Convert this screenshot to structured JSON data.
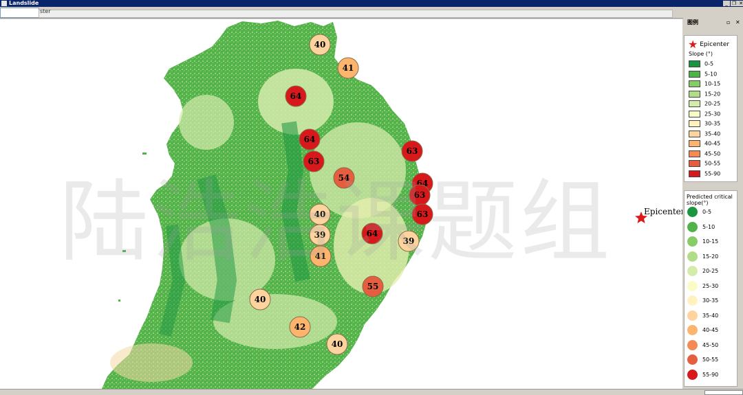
{
  "app": {
    "title": "Landslide"
  },
  "tabs": {
    "active_label": "ster"
  },
  "legend": {
    "header": "图例",
    "epicenter_label": "Epicenter",
    "slope_title": "Slope (°)",
    "slope_classes": [
      {
        "label": "0-5",
        "color": "#1a9641"
      },
      {
        "label": "5-10",
        "color": "#4fb34a"
      },
      {
        "label": "10-15",
        "color": "#86cc67"
      },
      {
        "label": "15-20",
        "color": "#b2dd88"
      },
      {
        "label": "20-25",
        "color": "#d5ebac"
      },
      {
        "label": "25-30",
        "color": "#fafcc8"
      },
      {
        "label": "30-35",
        "color": "#fff2c0"
      },
      {
        "label": "35-40",
        "color": "#fdd49e"
      },
      {
        "label": "40-45",
        "color": "#fdb56e"
      },
      {
        "label": "45-50",
        "color": "#f48b55"
      },
      {
        "label": "50-55",
        "color": "#e45e3f"
      },
      {
        "label": "55-90",
        "color": "#d7191c"
      }
    ],
    "critical_title": "Predicted critical slope(°)",
    "critical_classes": [
      {
        "label": "0-5",
        "color": "#1a9641"
      },
      {
        "label": "5-10",
        "color": "#4fb34a"
      },
      {
        "label": "10-15",
        "color": "#86cc67"
      },
      {
        "label": "15-20",
        "color": "#b2dd88"
      },
      {
        "label": "20-25",
        "color": "#d5ebac"
      },
      {
        "label": "25-30",
        "color": "#fafcc8"
      },
      {
        "label": "30-35",
        "color": "#fff2c0"
      },
      {
        "label": "35-40",
        "color": "#fdd49e"
      },
      {
        "label": "40-45",
        "color": "#fdb56e"
      },
      {
        "label": "45-50",
        "color": "#f48b55"
      },
      {
        "label": "50-55",
        "color": "#e45e3f"
      },
      {
        "label": "55-90",
        "color": "#d7191c"
      }
    ]
  },
  "map": {
    "epicenter_label": "Epicenter",
    "watermark": "陆浩浩课题组",
    "markers": [
      {
        "value": "40",
        "color": "#fdd49e"
      },
      {
        "value": "41",
        "color": "#fdb56e"
      },
      {
        "value": "64",
        "color": "#d7191c"
      },
      {
        "value": "64",
        "color": "#d7191c"
      },
      {
        "value": "63",
        "color": "#d7191c"
      },
      {
        "value": "54",
        "color": "#e45e3f"
      },
      {
        "value": "63",
        "color": "#d7191c"
      },
      {
        "value": "64",
        "color": "#d7191c"
      },
      {
        "value": "63",
        "color": "#d7191c"
      },
      {
        "value": "63",
        "color": "#d7191c"
      },
      {
        "value": "40",
        "color": "#fdd49e"
      },
      {
        "value": "39",
        "color": "#fdd49e"
      },
      {
        "value": "41",
        "color": "#fdb56e"
      },
      {
        "value": "64",
        "color": "#d7191c"
      },
      {
        "value": "39",
        "color": "#fdd49e"
      },
      {
        "value": "55",
        "color": "#e45e3f"
      },
      {
        "value": "40",
        "color": "#fdd49e"
      },
      {
        "value": "42",
        "color": "#fdb56e"
      },
      {
        "value": "40",
        "color": "#fdd49e"
      }
    ]
  }
}
